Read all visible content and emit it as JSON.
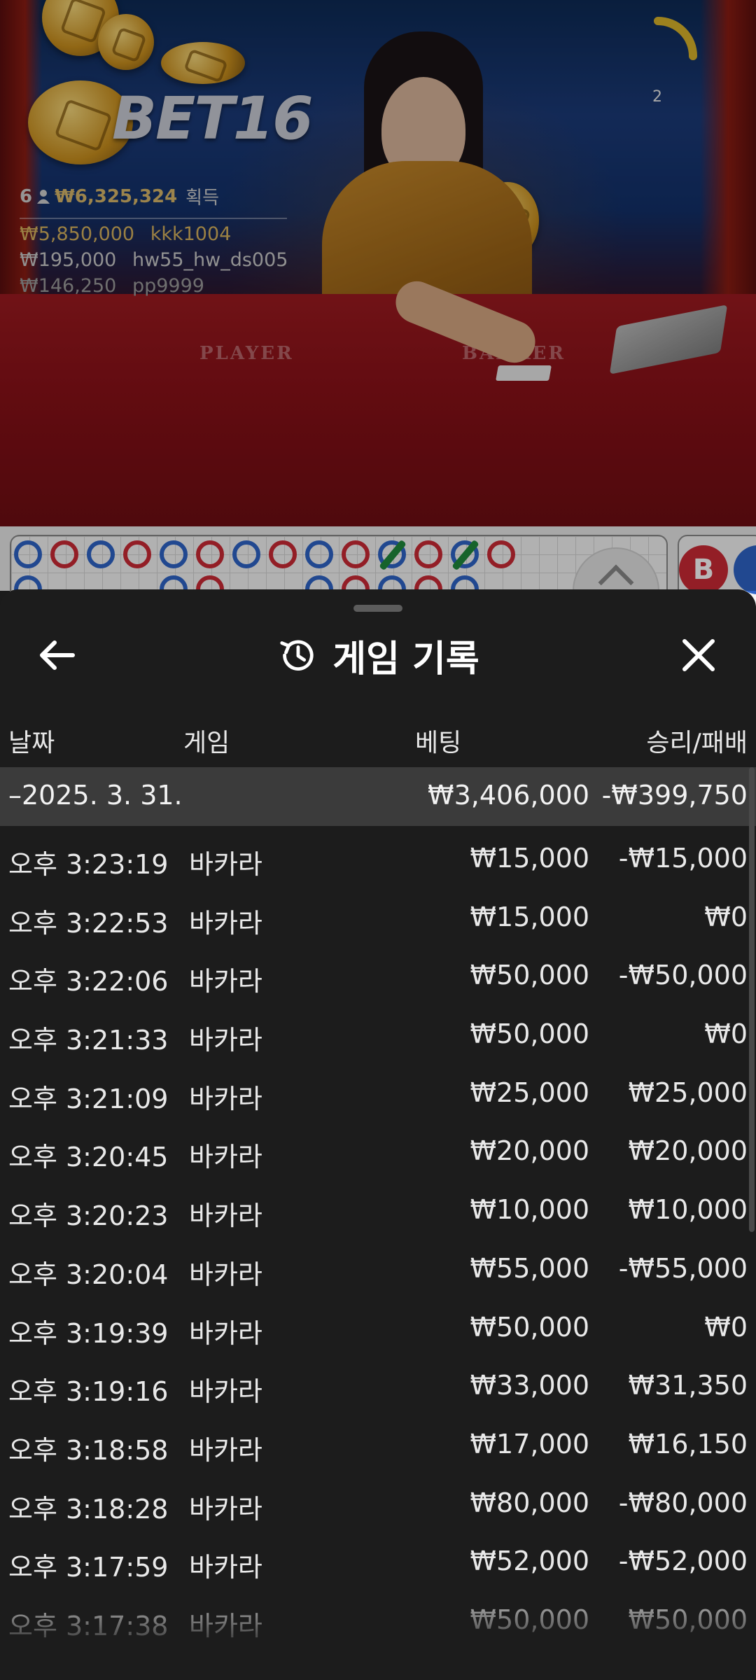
{
  "winners": {
    "count": "6",
    "total": "₩6,325,324",
    "suffix": "획득",
    "entries": [
      {
        "amount": "₩5,850,000",
        "user": "kkk1004"
      },
      {
        "amount": "₩195,000",
        "user": "hw55_hw_ds005"
      },
      {
        "amount": "₩146,250",
        "user": "pp9999"
      }
    ]
  },
  "brand": {
    "logo": "BET16"
  },
  "timer": {
    "count": "2"
  },
  "table_labels": {
    "player": "PLAYER",
    "banker": "BANKER"
  },
  "roadmap": {
    "bead_label": "B",
    "player_color": "#2f64c8",
    "banker_color": "#cc2a35",
    "tie_color": "#1f8a3c"
  },
  "sheet": {
    "title": "게임 기록",
    "headers": {
      "date": "날짜",
      "game": "게임",
      "bet": "베팅",
      "result": "승리/패배"
    },
    "day": {
      "date": "–2025. 3. 31.",
      "bet": "₩3,406,000",
      "result": "-₩399,750"
    },
    "rows": [
      {
        "time": "오후 3:23:19",
        "game": "바카라",
        "bet": "₩15,000",
        "result": "-₩15,000"
      },
      {
        "time": "오후 3:22:53",
        "game": "바카라",
        "bet": "₩15,000",
        "result": "₩0"
      },
      {
        "time": "오후 3:22:06",
        "game": "바카라",
        "bet": "₩50,000",
        "result": "-₩50,000"
      },
      {
        "time": "오후 3:21:33",
        "game": "바카라",
        "bet": "₩50,000",
        "result": "₩0"
      },
      {
        "time": "오후 3:21:09",
        "game": "바카라",
        "bet": "₩25,000",
        "result": "₩25,000"
      },
      {
        "time": "오후 3:20:45",
        "game": "바카라",
        "bet": "₩20,000",
        "result": "₩20,000"
      },
      {
        "time": "오후 3:20:23",
        "game": "바카라",
        "bet": "₩10,000",
        "result": "₩10,000"
      },
      {
        "time": "오후 3:20:04",
        "game": "바카라",
        "bet": "₩55,000",
        "result": "-₩55,000"
      },
      {
        "time": "오후 3:19:39",
        "game": "바카라",
        "bet": "₩50,000",
        "result": "₩0"
      },
      {
        "time": "오후 3:19:16",
        "game": "바카라",
        "bet": "₩33,000",
        "result": "₩31,350"
      },
      {
        "time": "오후 3:18:58",
        "game": "바카라",
        "bet": "₩17,000",
        "result": "₩16,150"
      },
      {
        "time": "오후 3:18:28",
        "game": "바카라",
        "bet": "₩80,000",
        "result": "-₩80,000"
      },
      {
        "time": "오후 3:17:59",
        "game": "바카라",
        "bet": "₩52,000",
        "result": "-₩52,000"
      },
      {
        "time": "오후 3:17:38",
        "game": "바카라",
        "bet": "₩50,000",
        "result": "₩50,000"
      }
    ]
  },
  "icons": {
    "back": "arrow-left-icon",
    "history": "history-clock-icon",
    "close": "close-icon"
  },
  "colors": {
    "sheet_bg": "#1c1c1c",
    "day_row_bg": "#3b3b3b",
    "gold": "#d9b86a"
  }
}
